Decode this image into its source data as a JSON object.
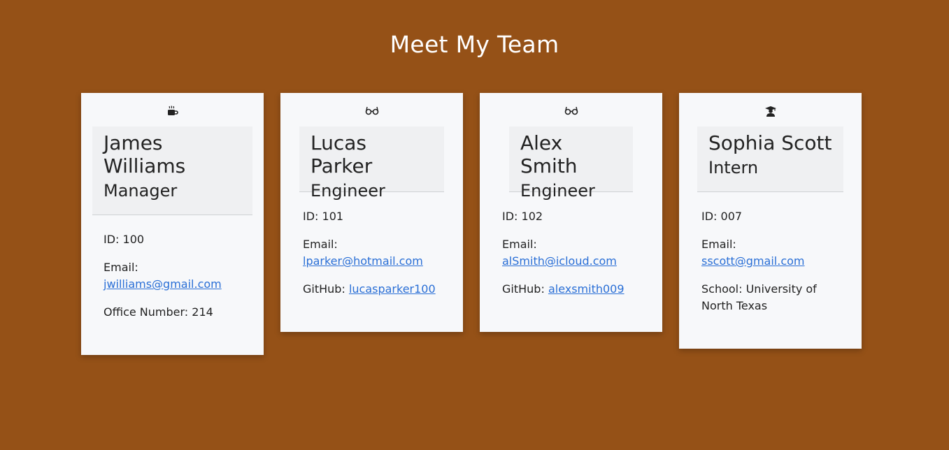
{
  "page": {
    "title": "Meet My Team"
  },
  "colors": {
    "background": "#955117",
    "card": "#f7f8fa",
    "header": "#eff0f2",
    "link": "#2a6fd6"
  },
  "cards": [
    {
      "icon": "coffee-mug-icon",
      "name": "James Williams",
      "role": "Manager",
      "id_text": "ID: 100",
      "email_label": "Email:",
      "email": "jwilliams@gmail.com",
      "extra_label": "Office Number: 214"
    },
    {
      "icon": "glasses-icon",
      "name": "Lucas Parker",
      "role": "Engineer",
      "id_text": "ID: 101",
      "email_label": "Email:",
      "email": "lparker@hotmail.com",
      "extra_label": "GitHub:",
      "extra_link": "lucasparker100"
    },
    {
      "icon": "glasses-icon",
      "name": "Alex Smith",
      "role": "Engineer",
      "id_text": "ID: 102",
      "email_label": "Email:",
      "email": "alSmith@icloud.com",
      "extra_label": "GitHub:",
      "extra_link": "alexsmith009"
    },
    {
      "icon": "graduate-icon",
      "name": "Sophia Scott",
      "role": "Intern",
      "id_text": "ID: 007",
      "email_label": "Email:",
      "email": "sscott@gmail.com",
      "extra_label": "School: University of North Texas"
    }
  ]
}
